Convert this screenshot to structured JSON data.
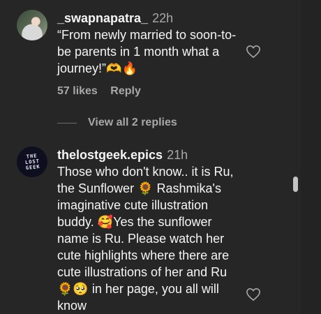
{
  "comments": [
    {
      "username": "_swapnapatra_",
      "time": "22h",
      "text": "“From newly married to soon-to-be parents in 1 month what a journey!”🫶🔥",
      "likes": "57 likes",
      "reply_label": "Reply",
      "view_replies": "View all 2 replies"
    },
    {
      "username": "thelostgeek.epics",
      "time": "21h",
      "text": "Those who don't know.. it is Ru, the Sunflower 🌻 Rashmika's imaginative cute illustration buddy. 🥰Yes the sunflower name is Ru. Please watch her cute highlights where there are cute illustrations of her and Ru 🌻🥺 in her page, you all will know",
      "avatar_text": [
        "THE",
        "LOST",
        "GEEK"
      ]
    }
  ]
}
